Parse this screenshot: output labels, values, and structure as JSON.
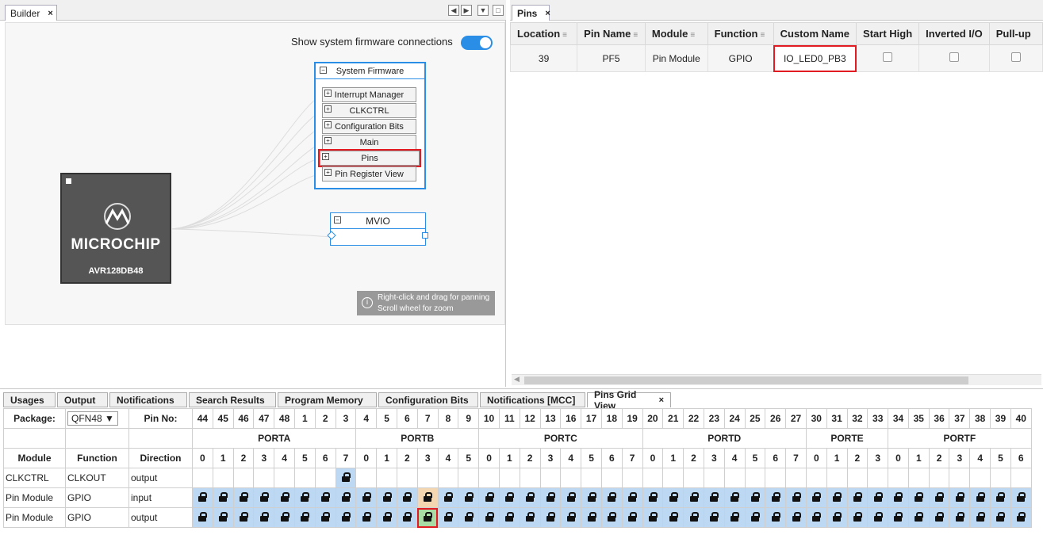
{
  "builder": {
    "tab_label": "Builder",
    "toggle_label": "Show system firmware connections",
    "toggle_on": true,
    "system_firmware": {
      "title": "System Firmware",
      "items": [
        "Interrupt Manager",
        "CLKCTRL",
        "Configuration Bits",
        "Main",
        "Pins",
        "Pin Register View"
      ],
      "highlighted": "Pins"
    },
    "chip": {
      "brand": "MICROCHIP",
      "part": "AVR128DB48"
    },
    "mvio_title": "MVIO",
    "hint": [
      "Right-click and drag for panning",
      "Scroll wheel for zoom"
    ]
  },
  "pins_panel": {
    "tab_label": "Pins",
    "columns": [
      "Location",
      "Pin Name",
      "Module",
      "Function",
      "Custom Name",
      "Start High",
      "Inverted I/O",
      "Pull-up"
    ],
    "sortable": [
      true,
      true,
      true,
      true,
      false,
      false,
      false,
      false
    ],
    "row": {
      "location": "39",
      "pin_name": "PF5",
      "module": "Pin Module",
      "function": "GPIO",
      "custom_name": "IO_LED0_PB3"
    }
  },
  "bottom_tabs": [
    "Usages",
    "Output",
    "Notifications",
    "Search Results",
    "Program Memory",
    "Configuration Bits",
    "Notifications [MCC]",
    "Pins Grid View"
  ],
  "active_bottom_tab": "Pins Grid View",
  "pins_grid": {
    "package_label": "Package:",
    "package_value": "QFN48",
    "pin_no_label": "Pin No:",
    "pin_numbers": [
      "44",
      "45",
      "46",
      "47",
      "48",
      "1",
      "2",
      "3",
      "4",
      "5",
      "6",
      "7",
      "8",
      "9",
      "10",
      "11",
      "12",
      "13",
      "16",
      "17",
      "18",
      "19",
      "20",
      "21",
      "22",
      "23",
      "24",
      "25",
      "26",
      "27",
      "30",
      "31",
      "32",
      "33",
      "34",
      "35",
      "36",
      "37",
      "38",
      "39",
      "40"
    ],
    "ports": [
      {
        "name": "PORTA",
        "bits": [
          "0",
          "1",
          "2",
          "3",
          "4",
          "5",
          "6",
          "7"
        ]
      },
      {
        "name": "PORTB",
        "bits": [
          "0",
          "1",
          "2",
          "3",
          "4",
          "5"
        ]
      },
      {
        "name": "PORTC",
        "bits": [
          "0",
          "1",
          "2",
          "3",
          "4",
          "5",
          "6",
          "7"
        ]
      },
      {
        "name": "PORTD",
        "bits": [
          "0",
          "1",
          "2",
          "3",
          "4",
          "5",
          "6",
          "7"
        ]
      },
      {
        "name": "PORTE",
        "bits": [
          "0",
          "1",
          "2",
          "3"
        ]
      },
      {
        "name": "PORTF",
        "bits": [
          "0",
          "1",
          "2",
          "3",
          "4",
          "5",
          "6"
        ]
      }
    ],
    "col_headers": [
      "Module",
      "Function",
      "Direction"
    ],
    "rows": [
      {
        "module": "CLKCTRL",
        "function": "CLKOUT",
        "direction": "output",
        "locks": [
          7
        ],
        "selected": [],
        "assigned": []
      },
      {
        "module": "Pin Module",
        "function": "GPIO",
        "direction": "input",
        "locks": "all",
        "selected": [
          11
        ],
        "assigned": []
      },
      {
        "module": "Pin Module",
        "function": "GPIO",
        "direction": "output",
        "locks": "all",
        "selected": [],
        "assigned": [
          11
        ]
      }
    ],
    "colors": {
      "available": "#bcd8f2",
      "selected_input": "#f4d7b0",
      "assigned": "#a9dca4",
      "highlight": "#e21b22"
    }
  }
}
